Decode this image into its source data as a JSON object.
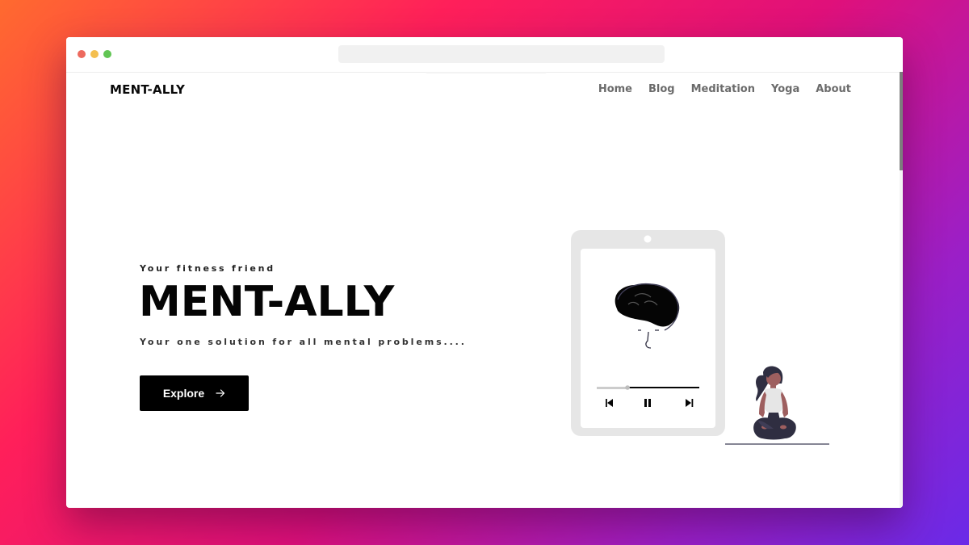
{
  "browser": {
    "controls": [
      "close",
      "minimize",
      "maximize"
    ]
  },
  "nav": {
    "logo": "MENT-ALLY",
    "items": [
      {
        "label": "Home"
      },
      {
        "label": "Blog"
      },
      {
        "label": "Meditation"
      },
      {
        "label": "Yoga"
      },
      {
        "label": "About"
      }
    ]
  },
  "hero": {
    "eyebrow": "Your fitness friend",
    "title": "MENT-ALLY",
    "tagline": "Your one solution for all mental problems....",
    "cta_label": "Explore",
    "cta_icon": "arrow-right-icon"
  },
  "illustration": {
    "device": "tablet",
    "media_player": {
      "progress": 0.3,
      "controls": [
        "previous-icon",
        "pause-icon",
        "next-icon"
      ]
    },
    "figure": "person-meditating"
  },
  "colors": {
    "background_gradient": [
      "#ff6a2f",
      "#ff1f5a",
      "#e0107a",
      "#9b1fc7",
      "#6a2ae8"
    ],
    "text_primary": "#050505",
    "nav_text": "#6b6b6b",
    "button_bg": "#000000",
    "skin": "#9e5f5f"
  }
}
